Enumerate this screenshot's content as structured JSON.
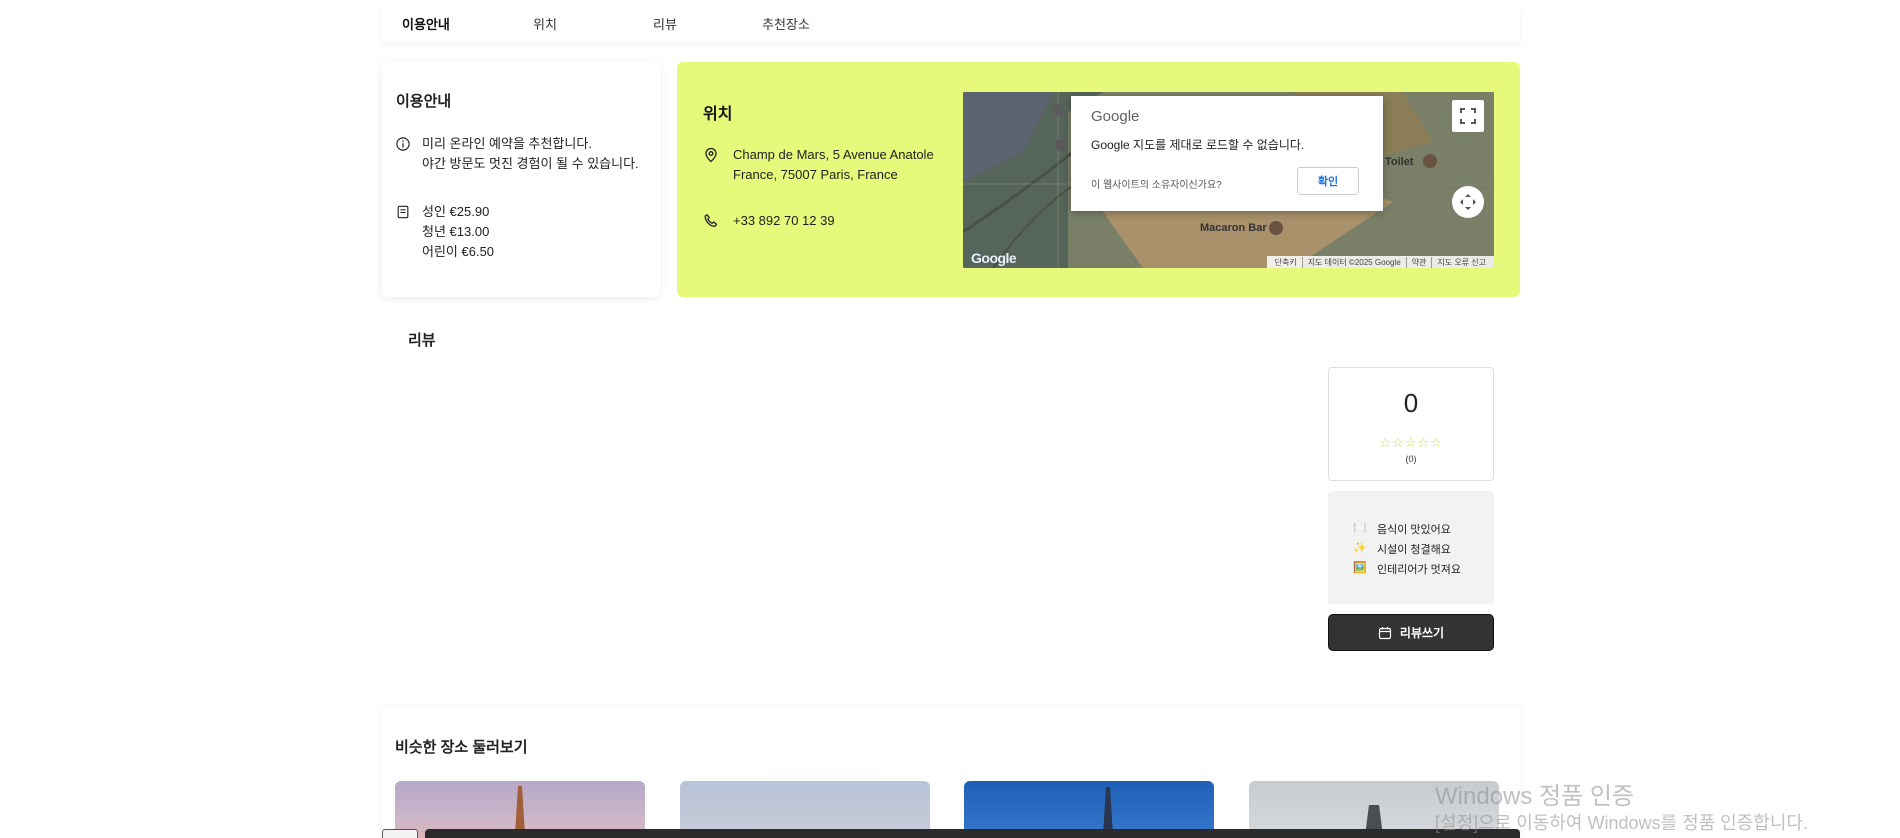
{
  "tabs": [
    {
      "label": "이용안내",
      "active": true
    },
    {
      "label": "위치",
      "active": false
    },
    {
      "label": "리뷰",
      "active": false
    },
    {
      "label": "추천장소",
      "active": false
    }
  ],
  "info": {
    "title": "이용안내",
    "notice_line1": "미리 온라인 예약을 추천합니다.",
    "notice_line2": "야간 방문도 멋진 경험이 될 수 있습니다.",
    "price_adult": "성인 €25.90",
    "price_youth": "청년 €13.00",
    "price_child": "어린이 €6.50"
  },
  "location": {
    "title": "위치",
    "address_line1": "Champ de Mars, 5 Avenue Anatole",
    "address_line2": "France, 75007 Paris, France",
    "phone": "+33 892 70 12 39"
  },
  "map": {
    "dialog_brand": "Google",
    "dialog_message": "Google 지도를 제대로 로드할 수 없습니다.",
    "dialog_owner_question": "이 웹사이트의 소유자이신가요?",
    "dialog_ok": "확인",
    "label_macaron": "Macaron Bar",
    "label_toilet": "Toilet",
    "logo": "Google",
    "footer": [
      "단축키",
      "지도 데이터 ©2025 Google",
      "약관",
      "지도 오류 신고"
    ]
  },
  "reviews": {
    "title": "리뷰",
    "score": "0",
    "stars": "☆☆☆☆☆",
    "count": "(0)",
    "tags": [
      {
        "emoji": "🍽️",
        "label": "음식이 맛있어요"
      },
      {
        "emoji": "✨",
        "label": "시설이 청결해요"
      },
      {
        "emoji": "🖼️",
        "label": "인테리어가 멋져요"
      }
    ],
    "write_button": "리뷰쓰기"
  },
  "similar": {
    "title": "비슷한 장소 둘러보기"
  },
  "watermark": {
    "line1": "Windows 정품 인증",
    "line2": "[설정]으로 이동하여 Windows를 정품 인증합니다."
  },
  "colors": {
    "accent": "#e6f97a",
    "dark_button": "#333333",
    "star": "#cddc39"
  }
}
